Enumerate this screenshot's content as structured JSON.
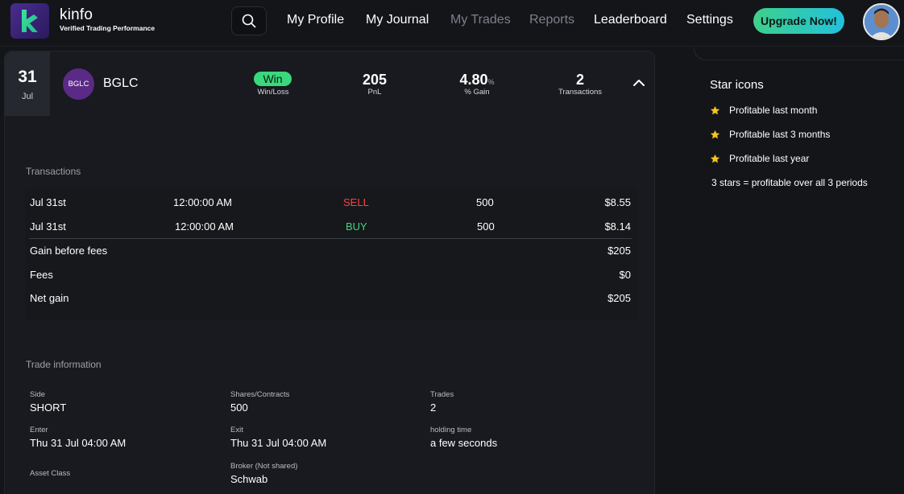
{
  "brand": {
    "name": "kinfo",
    "tagline": "Verified Trading Performance"
  },
  "nav": {
    "items": [
      {
        "label": "My Profile",
        "active": true
      },
      {
        "label": "My Journal",
        "active": true
      },
      {
        "label": "My Trades",
        "active": false
      },
      {
        "label": "Reports",
        "active": false
      },
      {
        "label": "Leaderboard",
        "active": true
      },
      {
        "label": "Settings",
        "active": true
      }
    ],
    "upgrade_label": "Upgrade Now!"
  },
  "trade": {
    "date_day": "31",
    "date_month": "Jul",
    "ticker_badge": "BGLC",
    "ticker": "BGLC",
    "result": "Win",
    "result_label": "Win/Loss",
    "pnl": "205",
    "pnl_label": "PnL",
    "pct_gain": "4.80",
    "pct_sign": "%",
    "pct_gain_label": "% Gain",
    "transactions_count": "2",
    "transactions_label": "Transactions"
  },
  "transactions": {
    "title": "Transactions",
    "rows": [
      {
        "date": "Jul 31st",
        "time": "12:00:00 AM",
        "side": "SELL",
        "qty": "500",
        "price": "$8.55"
      },
      {
        "date": "Jul 31st",
        "time": "12:00:00 AM",
        "side": "BUY",
        "qty": "500",
        "price": "$8.14"
      }
    ],
    "gain_before_fees_label": "Gain before fees",
    "gain_before_fees": "$205",
    "fees_label": "Fees",
    "fees": "$0",
    "net_gain_label": "Net gain",
    "net_gain": "$205"
  },
  "trade_info": {
    "title": "Trade information",
    "side_label": "Side",
    "side": "SHORT",
    "shares_label": "Shares/Contracts",
    "shares": "500",
    "trades_label": "Trades",
    "trades": "2",
    "enter_label": "Enter",
    "enter": "Thu 31 Jul 04:00 AM",
    "exit_label": "Exit",
    "exit": "Thu 31 Jul 04:00 AM",
    "holding_label": "holding time",
    "holding": "a few seconds",
    "asset_class_label": "Asset Class",
    "broker_label": "Broker (Not shared)",
    "broker": "Schwab"
  },
  "stars": {
    "title": "Star icons",
    "items": [
      "Profitable last month",
      "Profitable last 3 months",
      "Profitable last year"
    ],
    "note": "3 stars = profitable over all 3 periods"
  },
  "colors": {
    "background": "#131519",
    "card": "#181a1f",
    "win": "#39d87c",
    "sell": "#ff4242",
    "buy": "#3ed67d",
    "star": "#f5c518",
    "ticker_badge": "#5b2a86"
  }
}
